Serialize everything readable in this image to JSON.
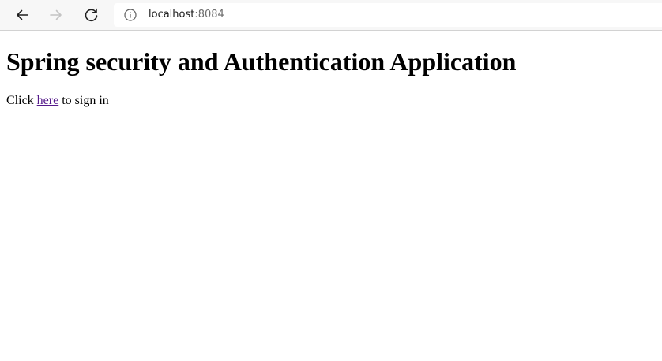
{
  "browser": {
    "url_host": "localhost",
    "url_port": ":8084",
    "icons": {
      "back": "back-arrow-icon",
      "forward": "forward-arrow-icon",
      "reload": "reload-icon",
      "site_info": "info-icon"
    }
  },
  "page": {
    "heading": "Spring security and Authentication Application",
    "prompt_prefix": "Click",
    "link_text": "here",
    "prompt_suffix": "to sign in",
    "link_color": "#551a8b"
  }
}
